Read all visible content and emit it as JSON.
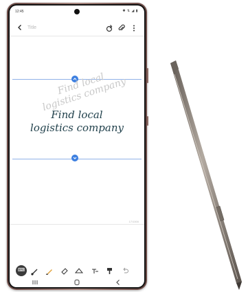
{
  "status_bar": {
    "time": "12:45",
    "icons": "✱ ⇅ ◢ ▮"
  },
  "toolbar": {
    "title_placeholder": "Title"
  },
  "note": {
    "handwriting_line1": "Find local",
    "handwriting_line2": "logistics company",
    "ghost_line1": "Find local",
    "ghost_line2": "logistics company",
    "char_count": "17/1000"
  },
  "pen_toolbar": {
    "tools": [
      "keyboard",
      "pen",
      "highlighter",
      "eraser",
      "lasso",
      "text-mode",
      "format",
      "undo"
    ]
  },
  "colors": {
    "accent": "#3d7fe0",
    "handwriting": "#1f3f4a",
    "phone_frame": "#a9877f",
    "stylus_body": "#8a8178"
  }
}
